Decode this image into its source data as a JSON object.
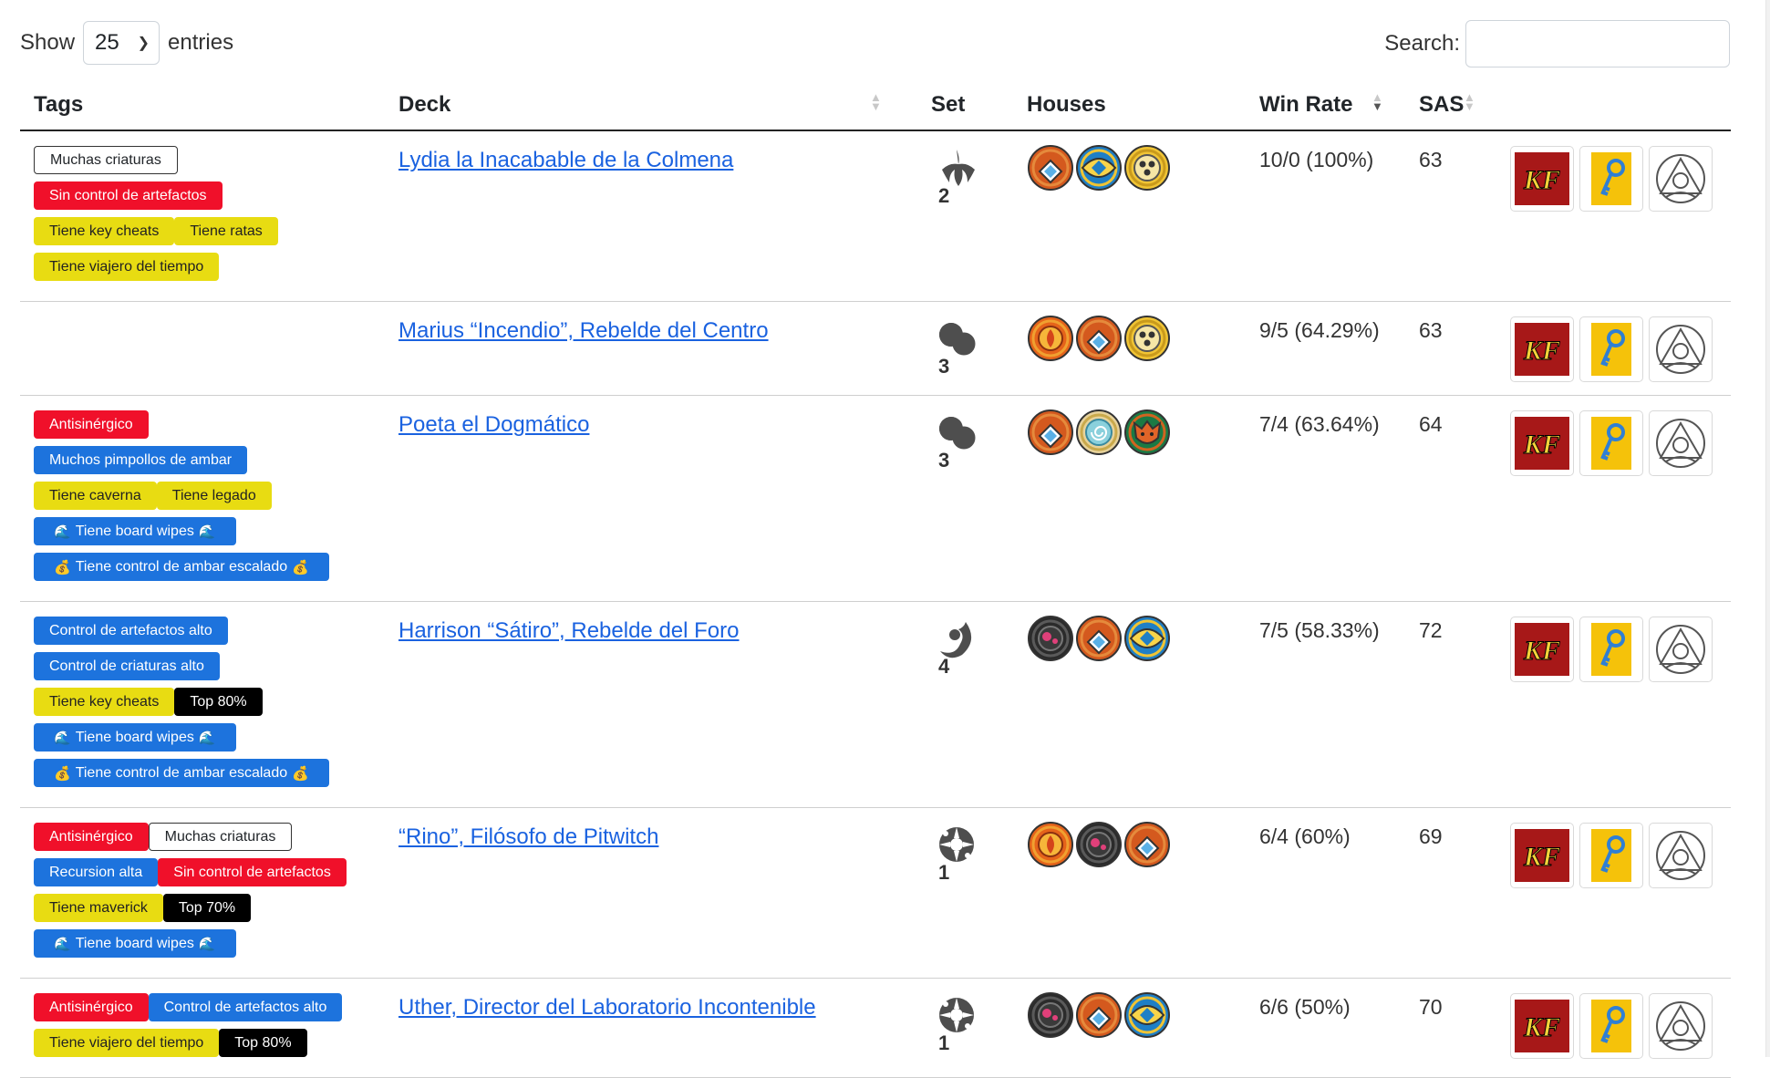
{
  "toolbar": {
    "show_label": "Show",
    "page_size": "25",
    "entries_label": "entries",
    "search_label": "Search:",
    "search_value": ""
  },
  "columns": {
    "tags": "Tags",
    "deck": "Deck",
    "set": "Set",
    "houses": "Houses",
    "win_rate": "Win Rate",
    "sas": "SAS"
  },
  "colors": {
    "tag_red": "#f0102a",
    "tag_blue": "#1d73dd",
    "tag_yellow": "#e8dc12",
    "tag_black": "#000000",
    "link": "#1a62e0"
  },
  "rows": [
    {
      "tag_lines": [
        [
          {
            "text": "Muchas criaturas",
            "style": "outline"
          }
        ],
        [
          {
            "text": "Sin control de artefactos",
            "style": "red"
          }
        ],
        [
          {
            "text": "Tiene key cheats",
            "style": "yellow"
          },
          {
            "text": "Tiene ratas",
            "style": "yellow"
          }
        ],
        [
          {
            "text": "Tiene viajero del tiempo",
            "style": "yellow"
          }
        ]
      ],
      "deck": "Lydia la Inacabable de la Colmena",
      "set_icon": "set-mass-mutation-icon",
      "set": "2",
      "houses": [
        "house-logos-icon",
        "house-sanctum-icon",
        "house-saurian-icon"
      ],
      "win_rate": "10/0 (100%)",
      "sas": "63"
    },
    {
      "tag_lines": [],
      "deck": "Marius “Incendio”, Rebelde del Centro",
      "set_icon": "set-worlds-collide-icon",
      "set": "3",
      "houses": [
        "house-dis-icon",
        "house-logos-icon",
        "house-saurian-icon"
      ],
      "win_rate": "9/5 (64.29%)",
      "sas": "63"
    },
    {
      "tag_lines": [
        [
          {
            "text": "Antisinérgico",
            "style": "red"
          }
        ],
        [
          {
            "text": "Muchos pimpollos de ambar",
            "style": "blue"
          }
        ],
        [
          {
            "text": "Tiene caverna",
            "style": "yellow"
          },
          {
            "text": "Tiene legado",
            "style": "yellow"
          }
        ],
        [
          {
            "text": "Tiene board wipes",
            "style": "blue",
            "emoji": "🌊"
          }
        ],
        [
          {
            "text": "Tiene control de ambar escalado",
            "style": "blue",
            "emoji": "💰"
          }
        ]
      ],
      "deck": "Poeta el Dogmático",
      "set_icon": "set-worlds-collide-icon",
      "set": "3",
      "houses": [
        "house-logos-icon",
        "house-unfathomable-icon",
        "house-untamed-icon"
      ],
      "win_rate": "7/4 (63.64%)",
      "sas": "64"
    },
    {
      "tag_lines": [
        [
          {
            "text": "Control de artefactos alto",
            "style": "blue"
          }
        ],
        [
          {
            "text": "Control de criaturas alto",
            "style": "blue"
          }
        ],
        [
          {
            "text": "Tiene key cheats",
            "style": "yellow"
          },
          {
            "text": "Top 80%",
            "style": "black"
          }
        ],
        [
          {
            "text": "Tiene board wipes",
            "style": "blue",
            "emoji": "🌊"
          }
        ],
        [
          {
            "text": "Tiene control de ambar escalado",
            "style": "blue",
            "emoji": "💰"
          }
        ]
      ],
      "deck": "Harrison “Sátiro”, Rebelde del Foro",
      "set_icon": "set-dark-tidings-icon",
      "set": "4",
      "houses": [
        "house-mars-icon",
        "house-logos-icon",
        "house-sanctum-icon"
      ],
      "win_rate": "7/5 (58.33%)",
      "sas": "72"
    },
    {
      "tag_lines": [
        [
          {
            "text": "Antisinérgico",
            "style": "red"
          },
          {
            "text": "Muchas criaturas",
            "style": "outline"
          }
        ],
        [
          {
            "text": "Recursion alta",
            "style": "blue"
          },
          {
            "text": "Sin control de artefactos",
            "style": "red"
          }
        ],
        [
          {
            "text": "Tiene maverick",
            "style": "yellow"
          },
          {
            "text": "Top 70%",
            "style": "black"
          }
        ],
        [
          {
            "text": "Tiene board wipes",
            "style": "blue",
            "emoji": "🌊"
          }
        ]
      ],
      "deck": "“Rino”, Filósofo de Pitwitch",
      "set_icon": "set-call-of-the-archons-icon",
      "set": "1",
      "houses": [
        "house-dis-icon",
        "house-mars-icon",
        "house-logos-icon"
      ],
      "win_rate": "6/4 (60%)",
      "sas": "69"
    },
    {
      "tag_lines": [
        [
          {
            "text": "Antisinérgico",
            "style": "red"
          },
          {
            "text": "Control de artefactos alto",
            "style": "blue"
          }
        ],
        [
          {
            "text": "Tiene viajero del tiempo",
            "style": "yellow"
          },
          {
            "text": "Top 80%",
            "style": "black"
          }
        ]
      ],
      "deck": "Uther, Director del Laboratorio Incontenible",
      "set_icon": "set-call-of-the-archons-icon",
      "set": "1",
      "houses": [
        "house-mars-icon",
        "house-logos-icon",
        "house-sanctum-icon"
      ],
      "win_rate": "6/6 (50%)",
      "sas": "70"
    }
  ],
  "row_actions": [
    {
      "name": "keyforge-site-icon",
      "glyph": "KF"
    },
    {
      "name": "key-icon"
    },
    {
      "name": "archon-arcana-icon"
    }
  ]
}
